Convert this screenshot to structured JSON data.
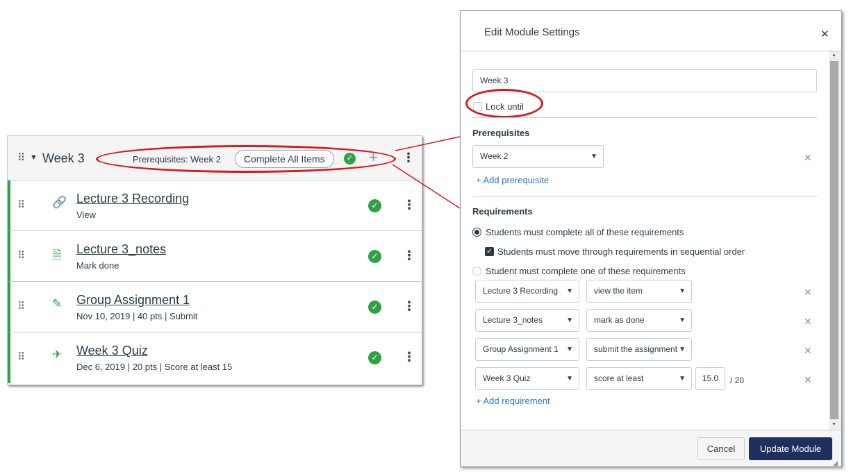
{
  "module": {
    "title": "Week 3",
    "prerequisites_text": "Prerequisites: Week 2",
    "completion_requirement": "Complete All Items",
    "items": [
      {
        "title": "Lecture 3 Recording",
        "meta": "View",
        "icon": "link-icon"
      },
      {
        "title": "Lecture 3_notes",
        "meta": "Mark done",
        "icon": "page-icon"
      },
      {
        "title": "Group Assignment 1",
        "meta": "Nov 10, 2019  |  40 pts  |  Submit",
        "icon": "assignment-icon"
      },
      {
        "title": "Week 3 Quiz",
        "meta": "Dec 6, 2019  |  20 pts  |  Score at least 15",
        "icon": "quiz-icon"
      }
    ]
  },
  "dialog": {
    "title": "Edit Module Settings",
    "module_name": "Week 3",
    "lock_until_label": "Lock until",
    "prerequisites_heading": "Prerequisites",
    "prerequisite_selected": "Week 2",
    "add_prerequisite": "+ Add prerequisite",
    "requirements_heading": "Requirements",
    "option_all": "Students must complete all of these requirements",
    "option_sequential": "Students must move through requirements in sequential order",
    "option_one": "Student must complete one of these requirements",
    "requirements": [
      {
        "item": "Lecture 3 Recording",
        "action": "view the item"
      },
      {
        "item": "Lecture 3_notes",
        "action": "mark as done"
      },
      {
        "item": "Group Assignment 1",
        "action": "submit the assignment"
      },
      {
        "item": "Week 3 Quiz",
        "action": "score at least",
        "score": "15.0",
        "max": "/ 20"
      }
    ],
    "add_requirement": "+ Add requirement",
    "cancel_label": "Cancel",
    "update_label": "Update Module"
  },
  "colors": {
    "complete_green": "#2fa147",
    "highlight_red": "#d7191c",
    "primary_button": "#1f2f5e",
    "link_blue": "#2b7abc"
  }
}
